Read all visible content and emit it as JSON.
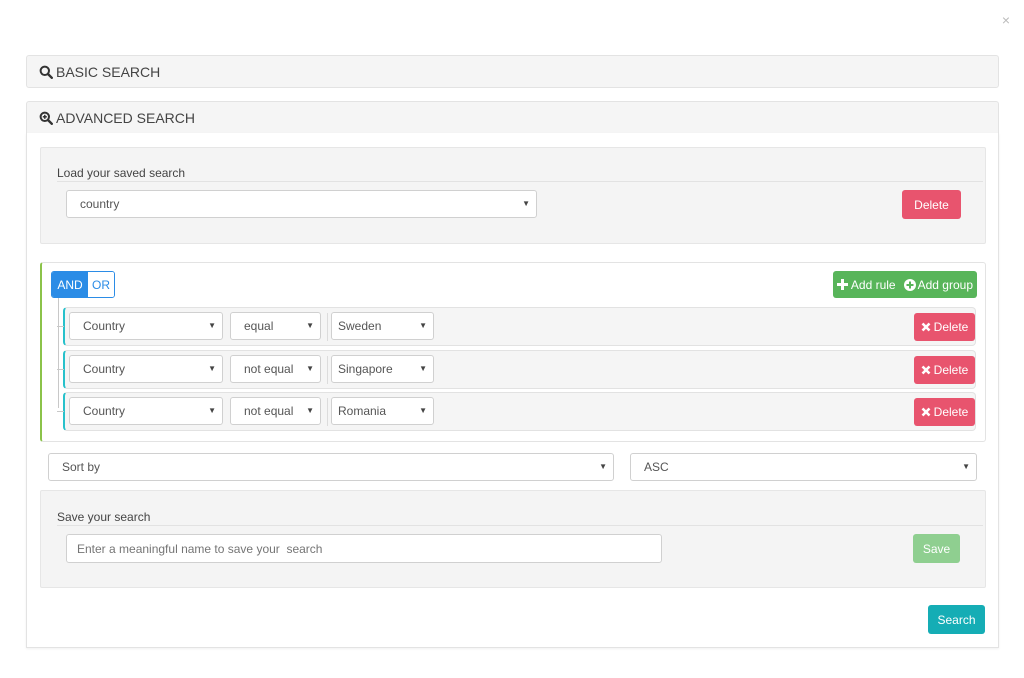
{
  "modal": {
    "close_icon": "×"
  },
  "basic_search": {
    "title": "BASIC SEARCH",
    "icon": "search-icon"
  },
  "advanced_search": {
    "title": "ADVANCED SEARCH",
    "icon": "zoom-in-icon",
    "load_saved": {
      "label": "Load your saved search",
      "selected": "country",
      "delete_label": "Delete"
    },
    "query_builder": {
      "conditions": [
        "AND",
        "OR"
      ],
      "active_condition": "AND",
      "add_rule_label": "Add rule",
      "add_group_label": "Add group",
      "rules": [
        {
          "field": "Country",
          "operator": "equal",
          "value": "Sweden",
          "delete_label": "Delete"
        },
        {
          "field": "Country",
          "operator": "not equal",
          "value": "Singapore",
          "delete_label": "Delete"
        },
        {
          "field": "Country",
          "operator": "not equal",
          "value": "Romania",
          "delete_label": "Delete"
        }
      ]
    },
    "sort": {
      "field_selected": "Sort by",
      "order_selected": "ASC"
    },
    "save_search": {
      "label": "Save your search",
      "placeholder": "Enter a meaningful name to save your  search",
      "value": "",
      "save_label": "Save"
    },
    "search_label": "Search"
  }
}
